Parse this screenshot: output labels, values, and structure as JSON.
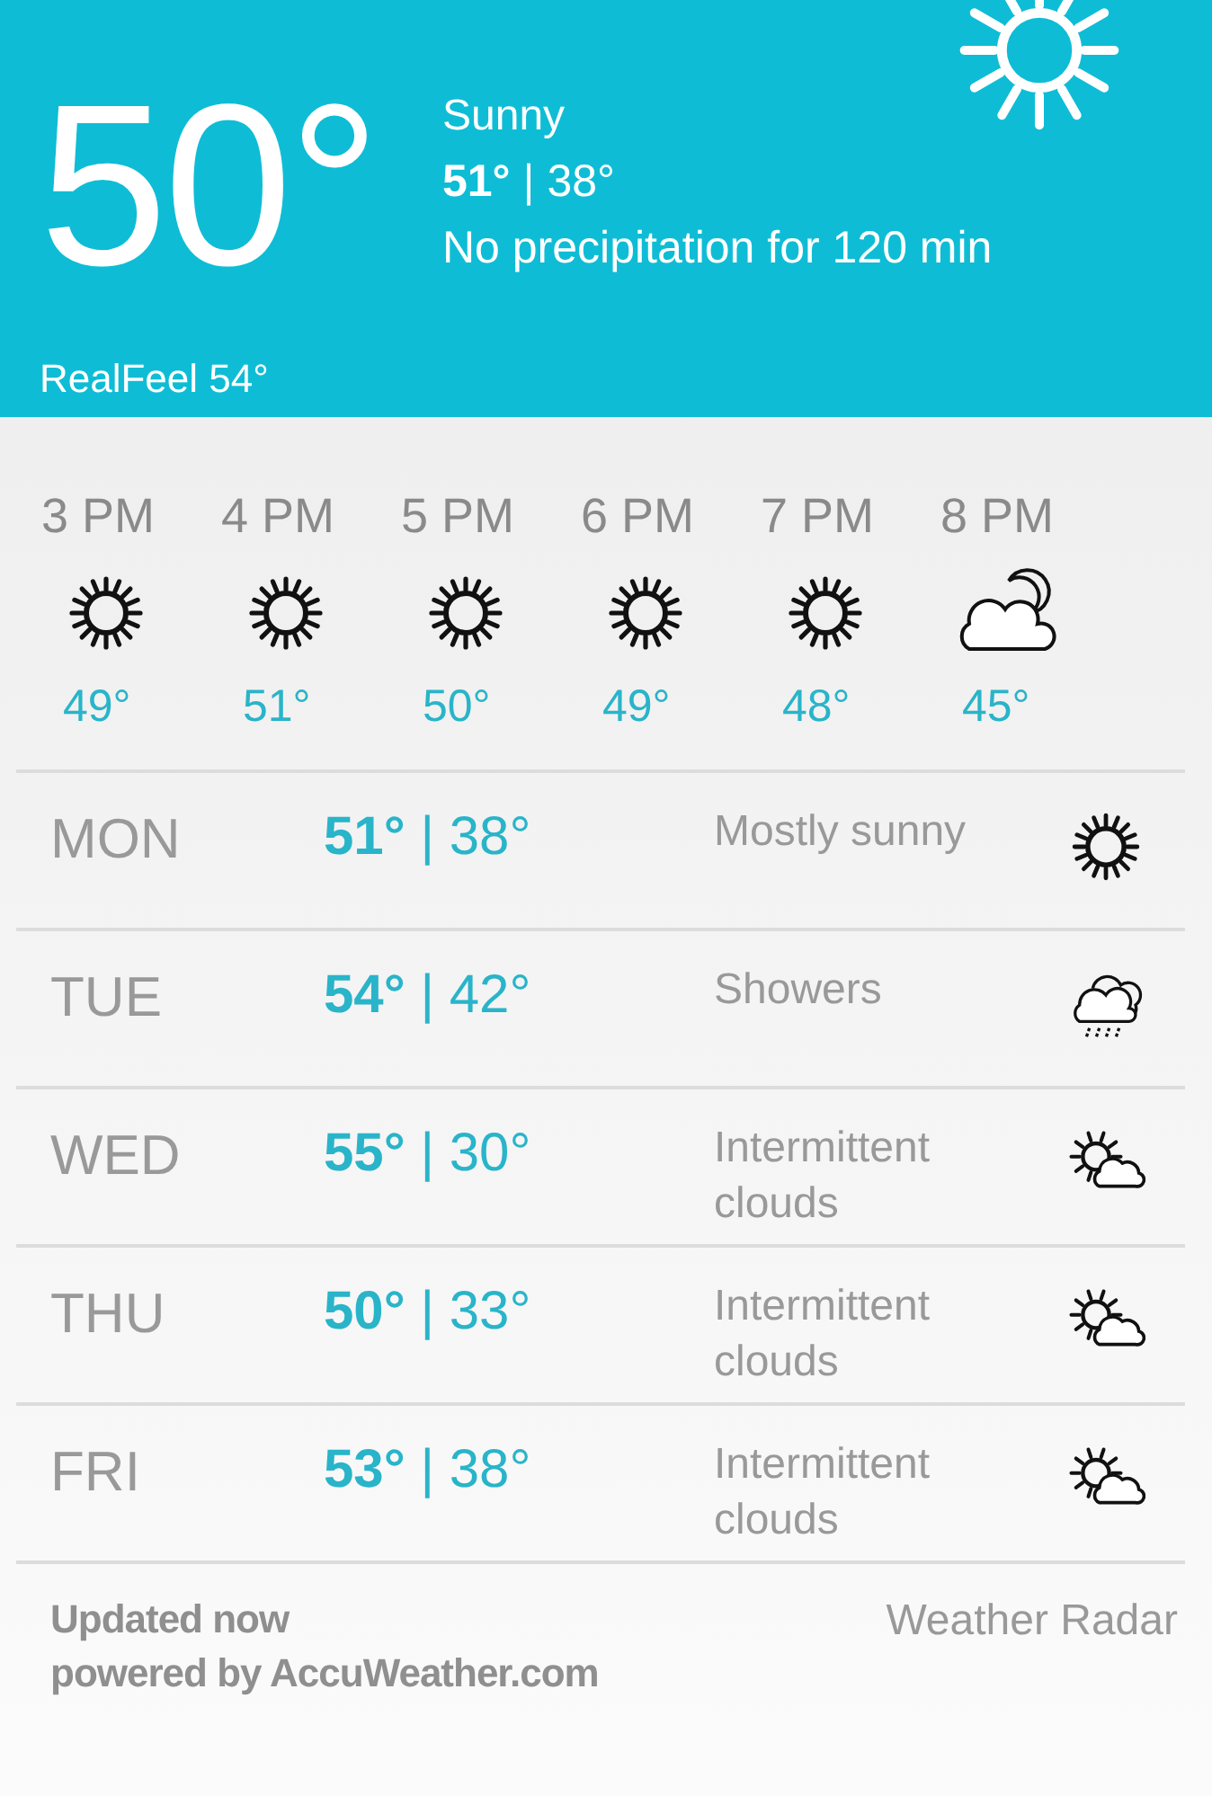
{
  "current": {
    "temperature": "50°",
    "condition": "Sunny",
    "high_low": "**51°** | 38°",
    "precipitation": "No precipitation for 120 min",
    "realfeel": "RealFeel 54°"
  },
  "hourly": [
    {
      "time": "3 PM",
      "kind": "sun",
      "temp": "49°"
    },
    {
      "time": "4 PM",
      "kind": "sun",
      "temp": "51°"
    },
    {
      "time": "5 PM",
      "kind": "sun",
      "temp": "50°"
    },
    {
      "time": "6 PM",
      "kind": "sun",
      "temp": "49°"
    },
    {
      "time": "7 PM",
      "kind": "sun",
      "temp": "48°"
    },
    {
      "time": "8 PM",
      "kind": "moon-cloud",
      "temp": "45°"
    }
  ],
  "daily": [
    {
      "day": "MON",
      "high_low": "**51°** | 38°",
      "condition": "Mostly sunny",
      "kind": "sun"
    },
    {
      "day": "TUE",
      "high_low": "**54°** | 42°",
      "condition": "Showers",
      "kind": "rain"
    },
    {
      "day": "WED",
      "high_low": "**55°** | 30°",
      "condition": "Intermittent clouds",
      "kind": "sun-cloud"
    },
    {
      "day": "THU",
      "high_low": "**50°** | 33°",
      "condition": "Intermittent clouds",
      "kind": "sun-cloud"
    },
    {
      "day": "FRI",
      "high_low": "**53°** | 38°",
      "condition": "Intermittent clouds",
      "kind": "sun-cloud"
    }
  ],
  "footer": {
    "updated": "Updated now",
    "powered_by": "powered by AccuWeather.com",
    "radar_link": "Weather Radar"
  }
}
